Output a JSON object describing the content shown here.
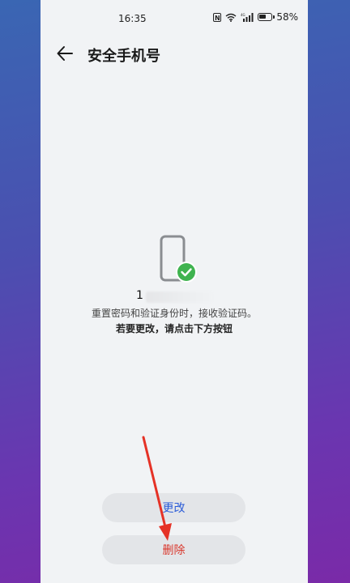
{
  "status_bar": {
    "time": "16:35",
    "nfc": "N",
    "battery_percent": "58%"
  },
  "header": {
    "title": "安全手机号"
  },
  "content": {
    "number_prefix": "1",
    "description_line1": "重置密码和验证身份时，接收验证码。",
    "description_line2": "若要更改，请点击下方按钮"
  },
  "buttons": {
    "change_label": "更改",
    "delete_label": "删除"
  },
  "colors": {
    "accent_blue": "#2a5bd7",
    "delete_red": "#d9362b",
    "check_green": "#3fb34f",
    "annotation_arrow": "#e53226"
  }
}
